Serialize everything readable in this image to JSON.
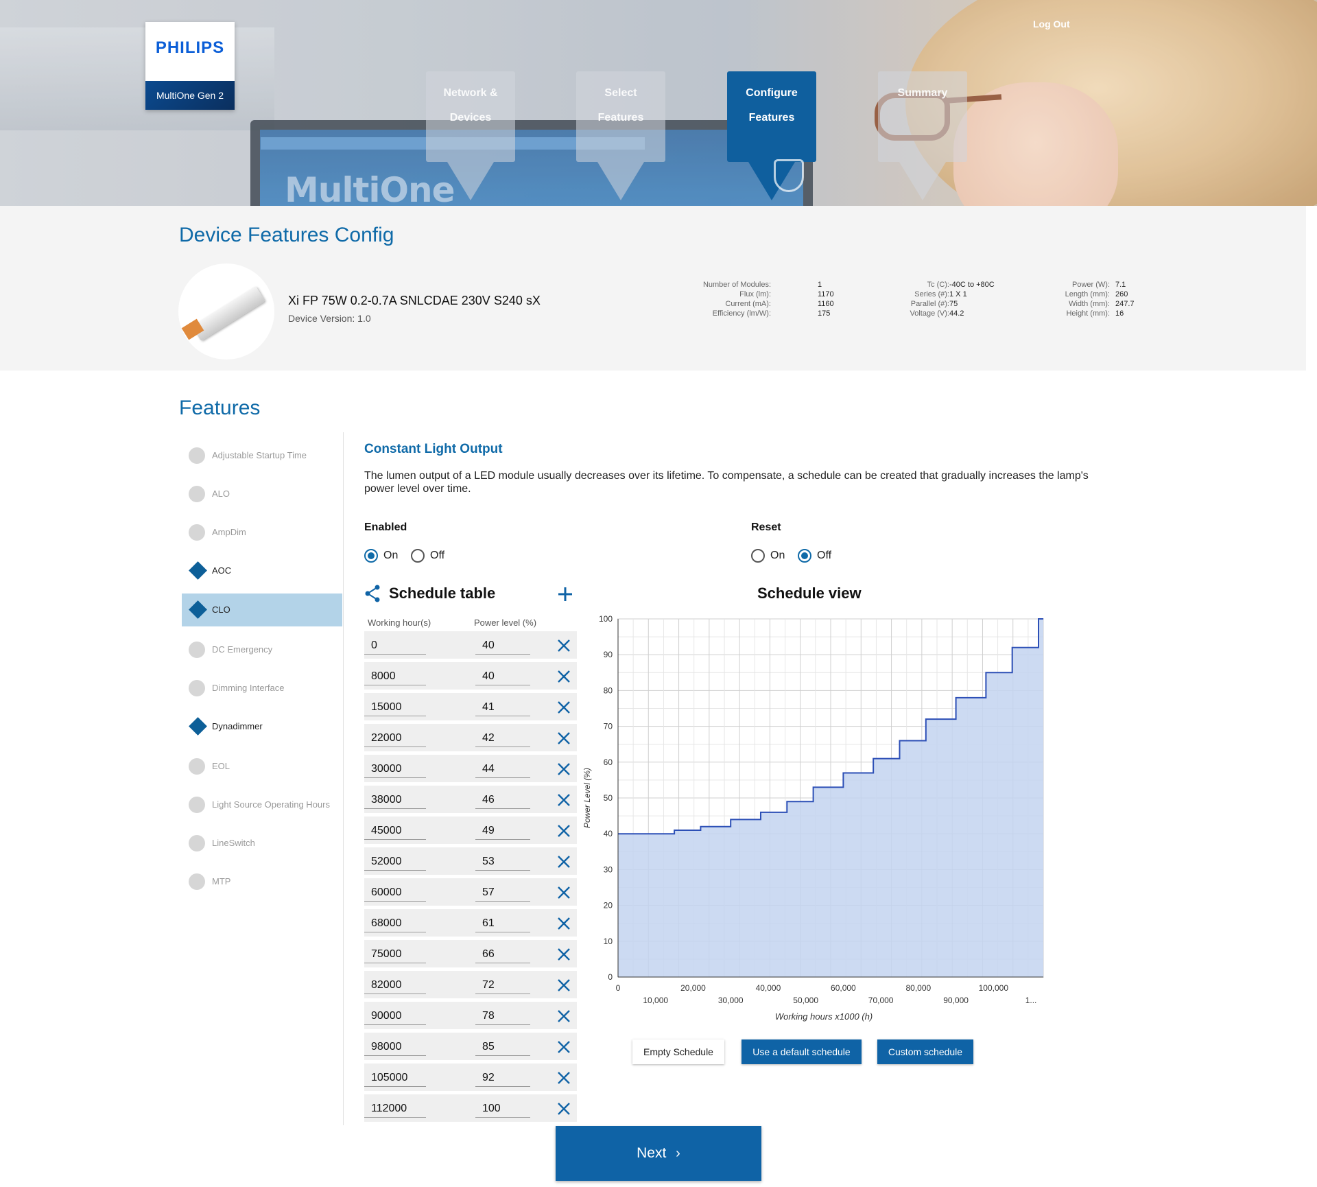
{
  "header": {
    "logo_brand": "PHILIPS",
    "logo_product": "MultiOne Gen 2",
    "logout_label": "Log Out",
    "steps": [
      {
        "line1": "Network &",
        "line2": "Devices",
        "active": false
      },
      {
        "line1": "Select",
        "line2": "Features",
        "active": false
      },
      {
        "line1": "Configure",
        "line2": "Features",
        "active": true
      },
      {
        "line1": "Summary",
        "line2": "",
        "active": false
      }
    ],
    "background_text": "MultiOne"
  },
  "device": {
    "section_title": "Device Features Config",
    "name": "Xi FP 75W 0.2-0.7A SNLCDAE 230V S240 sX",
    "version": "Device Version: 1.0",
    "specs": [
      [
        {
          "label": "Number of Modules:",
          "value": "1"
        },
        {
          "label": "Flux (lm):",
          "value": "1170"
        },
        {
          "label": "Current (mA):",
          "value": "1160"
        },
        {
          "label": "Efficiency (lm/W):",
          "value": "175"
        }
      ],
      [
        {
          "label": "Tc (C):",
          "value": "-40C to +80C"
        },
        {
          "label": "Series (#):",
          "value": "1 X 1"
        },
        {
          "label": "Parallel (#):",
          "value": "75"
        },
        {
          "label": "Voltage (V):",
          "value": "44.2"
        }
      ],
      [
        {
          "label": "Power (W):",
          "value": "7.1"
        },
        {
          "label": "Length (mm):",
          "value": "260"
        },
        {
          "label": "Width (mm):",
          "value": "247.7"
        },
        {
          "label": "Height (mm):",
          "value": "16"
        }
      ]
    ]
  },
  "features": {
    "section_title": "Features",
    "items": [
      {
        "label": "Adjustable Startup Time",
        "marker": "dot",
        "enabled": false,
        "selected": false
      },
      {
        "label": "ALO",
        "marker": "dot",
        "enabled": false,
        "selected": false
      },
      {
        "label": "AmpDim",
        "marker": "dot",
        "enabled": false,
        "selected": false
      },
      {
        "label": "AOC",
        "marker": "diamond",
        "enabled": true,
        "selected": false
      },
      {
        "label": "CLO",
        "marker": "diamond",
        "enabled": true,
        "selected": true
      },
      {
        "label": "DC Emergency",
        "marker": "dot",
        "enabled": false,
        "selected": false
      },
      {
        "label": "Dimming Interface",
        "marker": "dot",
        "enabled": false,
        "selected": false
      },
      {
        "label": "Dynadimmer",
        "marker": "diamond",
        "enabled": true,
        "selected": false
      },
      {
        "label": "EOL",
        "marker": "dot",
        "enabled": false,
        "selected": false
      },
      {
        "label": "Light Source Operating Hours",
        "marker": "dot",
        "enabled": false,
        "selected": false
      },
      {
        "label": "LineSwitch",
        "marker": "dot",
        "enabled": false,
        "selected": false
      },
      {
        "label": "MTP",
        "marker": "dot",
        "enabled": false,
        "selected": false
      }
    ]
  },
  "clo": {
    "title": "Constant Light Output",
    "description": "The lumen output of a LED module usually decreases over its lifetime. To compensate, a schedule can be created that gradually increases the lamp's power level over time.",
    "enabled_label": "Enabled",
    "enabled_value": "On",
    "reset_label": "Reset",
    "reset_value": "Off",
    "on_label": "On",
    "off_label": "Off",
    "schedule_table_title": "Schedule table",
    "col_hours": "Working hour(s)",
    "col_power": "Power level (%)",
    "schedule_view_title": "Schedule view",
    "buttons": {
      "empty": "Empty Schedule",
      "default": "Use a default schedule",
      "custom": "Custom schedule"
    },
    "next_label": "Next"
  },
  "schedule": [
    {
      "hours": "0",
      "power": "40"
    },
    {
      "hours": "8000",
      "power": "40"
    },
    {
      "hours": "15000",
      "power": "41"
    },
    {
      "hours": "22000",
      "power": "42"
    },
    {
      "hours": "30000",
      "power": "44"
    },
    {
      "hours": "38000",
      "power": "46"
    },
    {
      "hours": "45000",
      "power": "49"
    },
    {
      "hours": "52000",
      "power": "53"
    },
    {
      "hours": "60000",
      "power": "57"
    },
    {
      "hours": "68000",
      "power": "61"
    },
    {
      "hours": "75000",
      "power": "66"
    },
    {
      "hours": "82000",
      "power": "72"
    },
    {
      "hours": "90000",
      "power": "78"
    },
    {
      "hours": "98000",
      "power": "85"
    },
    {
      "hours": "105000",
      "power": "92"
    },
    {
      "hours": "112000",
      "power": "100"
    }
  ],
  "chart_data": {
    "type": "area",
    "step": true,
    "x": [
      0,
      8000,
      15000,
      22000,
      30000,
      38000,
      45000,
      52000,
      60000,
      68000,
      75000,
      82000,
      90000,
      98000,
      105000,
      112000
    ],
    "y": [
      40,
      40,
      41,
      42,
      44,
      46,
      49,
      53,
      57,
      61,
      66,
      72,
      78,
      85,
      92,
      100
    ],
    "xlim": [
      0,
      112000
    ],
    "ylim": [
      0,
      100
    ],
    "xlabel": "Working hours x1000 (h)",
    "ylabel": "Power Level (%)",
    "x_ticks_upper": [
      "0",
      "20,000",
      "40,000",
      "60,000",
      "80,000",
      "100,000"
    ],
    "x_ticks_lower": [
      "10,000",
      "30,000",
      "50,000",
      "70,000",
      "90,000",
      "1..."
    ],
    "y_ticks": [
      "0",
      "10",
      "20",
      "30",
      "40",
      "50",
      "60",
      "70",
      "80",
      "90",
      "100"
    ],
    "grid": true,
    "fill_color": "#c3d3f0",
    "line_color": "#2c4fb6"
  },
  "colors": {
    "accent": "#0f63a6",
    "title": "#0f6aa8",
    "selected_row": "#b3d3e8"
  }
}
